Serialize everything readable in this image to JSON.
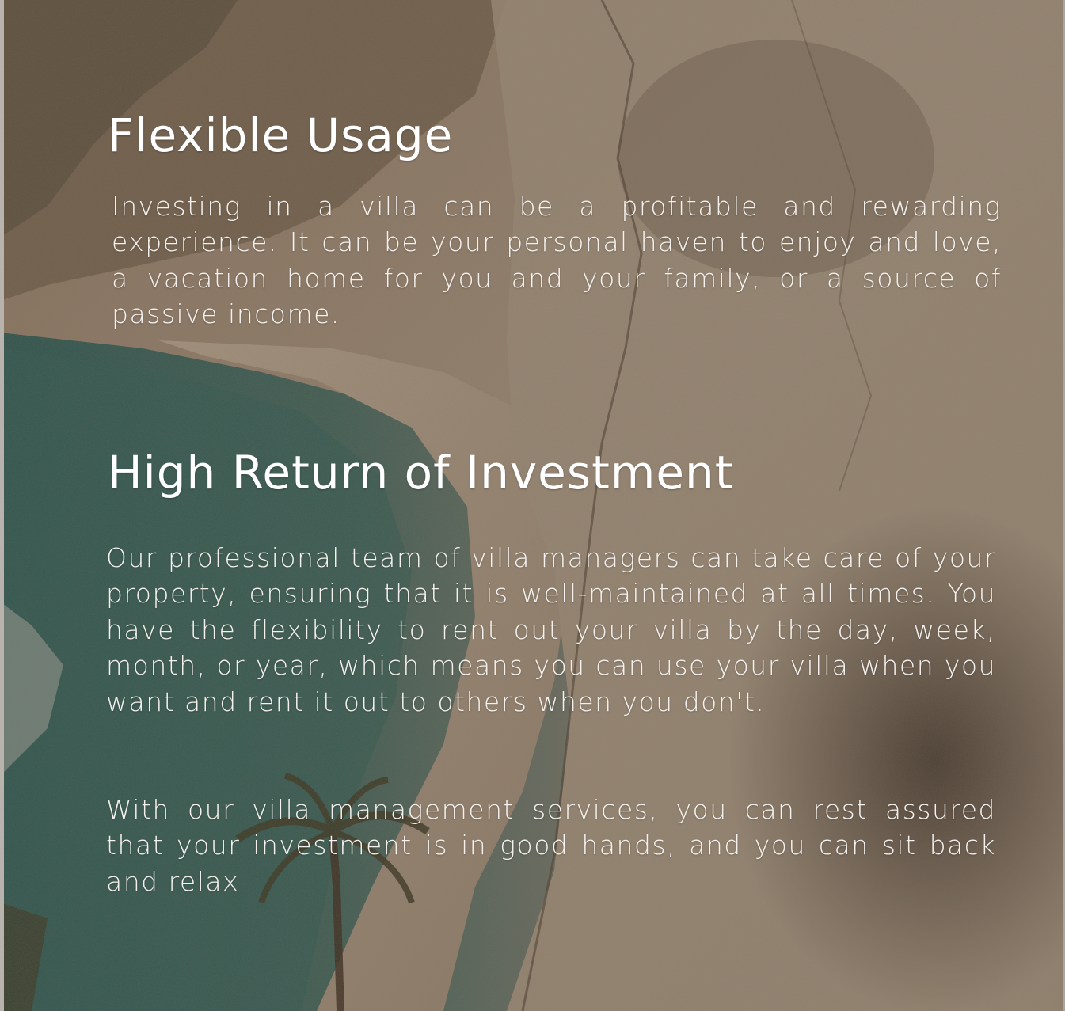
{
  "section1": {
    "title": "Flexible Usage",
    "body": "Investing in a villa can be a profitable and rewarding experience. It can be your personal haven to enjoy and love, a vacation home for you and your family, or a source of passive income."
  },
  "section2": {
    "title": "High Return of Investment",
    "paragraphs": [
      "Our professional team of villa managers can take care of your property, ensuring that it is well-maintained at all times. You have the flexibility to rent out your villa by the day, week, month, or year, which means you can use your villa when you want and rent it out to others when you don't.",
      "With our villa management services, you can rest assured that your investment is in good hands, and you can sit back and relax"
    ]
  },
  "colors": {
    "text": "#ffffff",
    "cliff": "#b7a58f",
    "sea": "#1f5f5c",
    "sand": "#c6b49d"
  }
}
